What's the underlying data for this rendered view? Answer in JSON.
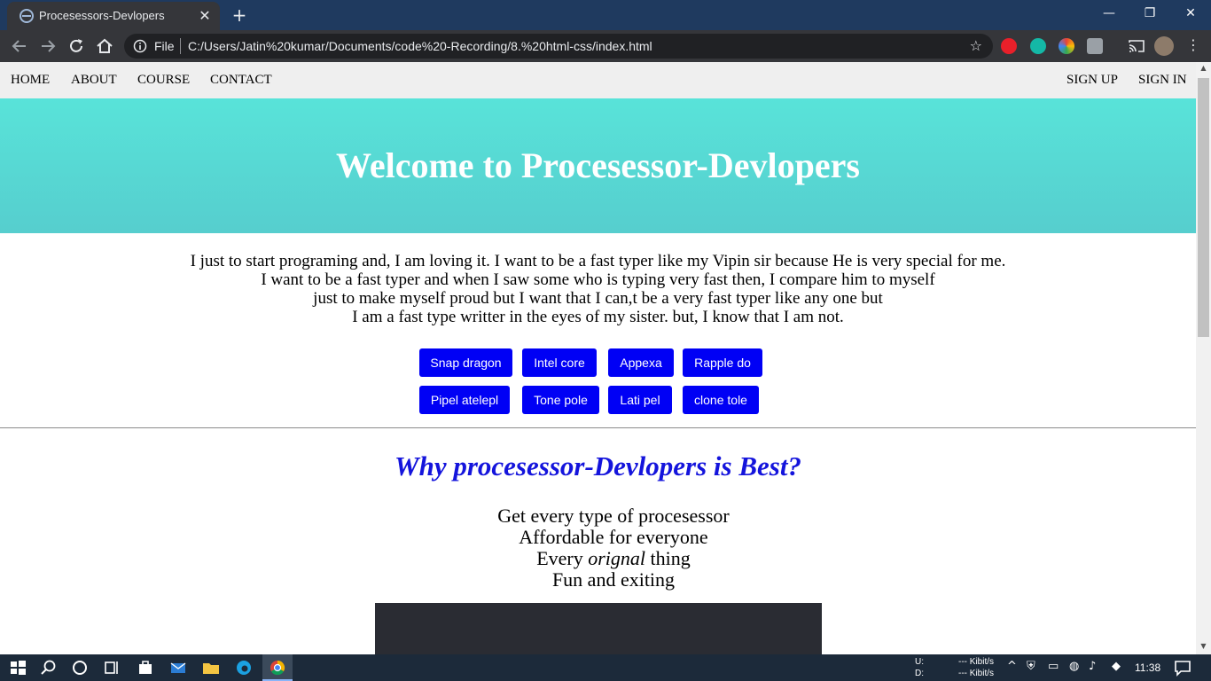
{
  "browser": {
    "tab_title": "Procesessors-Devlopers",
    "address_scheme_label": "File",
    "url": "C:/Users/Jatin%20kumar/Documents/code%20-Recording/8.%20html-css/index.html"
  },
  "site": {
    "nav_left": [
      "HOME",
      "ABOUT",
      "COURSE",
      "CONTACT"
    ],
    "nav_right": [
      "SIGN UP",
      "SIGN IN"
    ],
    "hero_title": "Welcome to Procesessor-Devlopers",
    "intro_lines": [
      "I just to start programing and, I am loving it. I want to be a fast typer like my Vipin sir because He is very special for me.",
      "I want to be a fast typer and when I saw some who is typing very fast then, I compare him to myself",
      "just to make myself proud but I want that I can,t be a very fast typer like any one but",
      "I am a fast type writter in the eyes of my sister. but, I know that I am not."
    ],
    "buttons_row1": [
      "Snap dragon",
      "Intel core",
      "Appexa",
      "Rapple do"
    ],
    "buttons_row2": [
      "Pipel atelepl",
      "Tone pole",
      "Lati pel",
      "clone tole"
    ],
    "why_heading": "Why procesessor-Devlopers is Best?",
    "features": {
      "line1": "Get every type of procesessor",
      "line2": "Affordable for everyone",
      "line3_a": "Every",
      "line3_em": "orignal",
      "line3_b": "thing",
      "line4": "Fun and exiting"
    }
  },
  "taskbar": {
    "net_up_label": "U:",
    "net_down_label": "D:",
    "net_up_value": "--- Kibit/s",
    "net_down_value": "--- Kibit/s",
    "clock": "11:38"
  },
  "colors": {
    "hero": "#58e3d9",
    "button": "#0000f5",
    "heading": "#1414dc"
  }
}
